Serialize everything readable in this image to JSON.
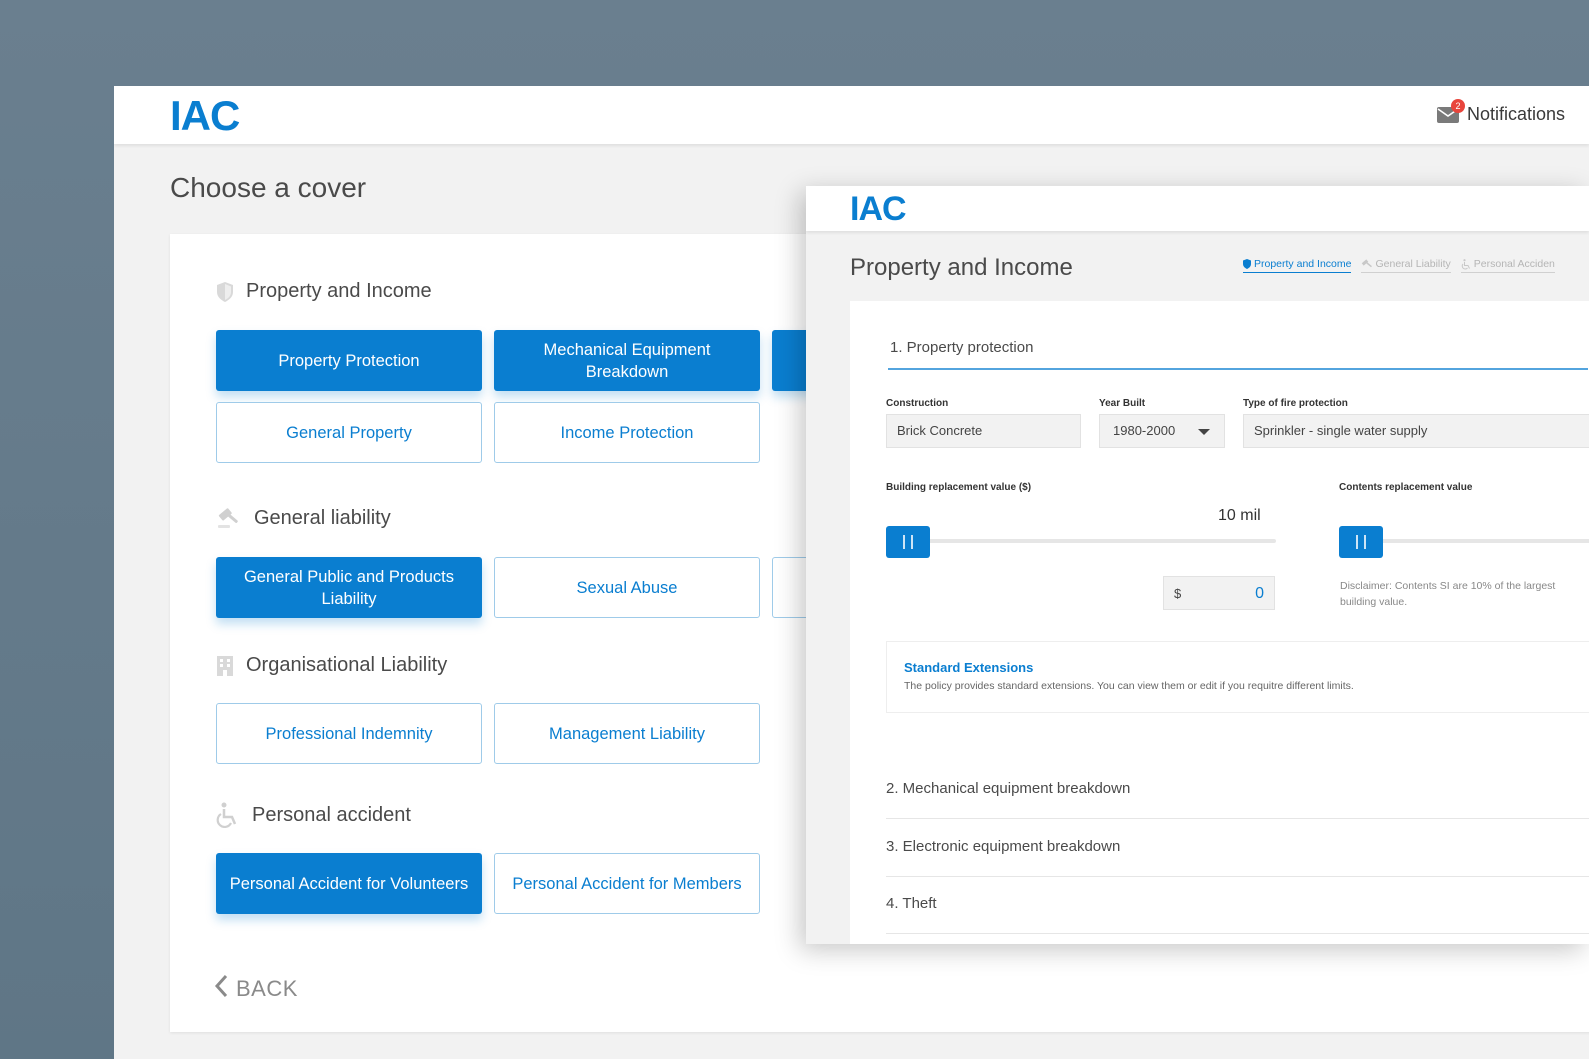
{
  "back_window": {
    "logo": "IAC",
    "notifications": {
      "label": "Notifications",
      "count": "2"
    },
    "title": "Choose a cover",
    "categories": {
      "property": {
        "title": "Property and Income",
        "buttons": [
          "Property Protection",
          "Mechanical Equipment Breakdown",
          "General Property",
          "Income Protection"
        ]
      },
      "liability": {
        "title": "General liability",
        "buttons": [
          "General Public and Products Liability",
          "Sexual Abuse"
        ]
      },
      "organisational": {
        "title": "Organisational Liability",
        "buttons": [
          "Professional Indemnity",
          "Management Liability"
        ]
      },
      "accident": {
        "title": "Personal accident",
        "buttons": [
          "Personal Accident for Volunteers",
          "Personal Accident for Members"
        ]
      }
    },
    "back_label": "BACK"
  },
  "front_window": {
    "logo": "IAC",
    "title": "Property and Income",
    "crumbs": [
      "Property and Income",
      "General Liability",
      "Personal Acciden"
    ],
    "section1": "1. Property protection",
    "fields": {
      "construction": {
        "label": "Construction",
        "value": "Brick Concrete"
      },
      "year_built": {
        "label": "Year Built",
        "value": "1980-2000"
      },
      "fire_protection": {
        "label": "Type of fire protection",
        "value": "Sprinkler - single water supply"
      }
    },
    "building_value": {
      "label": "Building replacement value ($)",
      "display": "10 mil",
      "currency": "$",
      "amount": "0"
    },
    "contents_value": {
      "label": "Contents replacement value",
      "disclaimer": "Disclaimer: Contents SI are 10% of the largest building value."
    },
    "extensions": {
      "title": "Standard Extensions",
      "desc": "The policy provides standard extensions. You can view them or edit if you requitre different limits."
    },
    "sections": [
      "2. Mechanical equipment breakdown",
      "3. Electronic equipment breakdown",
      "4. Theft"
    ]
  },
  "colors": {
    "accent": "#0a7ed0",
    "background": "#6a7f8f",
    "badge": "#e8453c"
  }
}
